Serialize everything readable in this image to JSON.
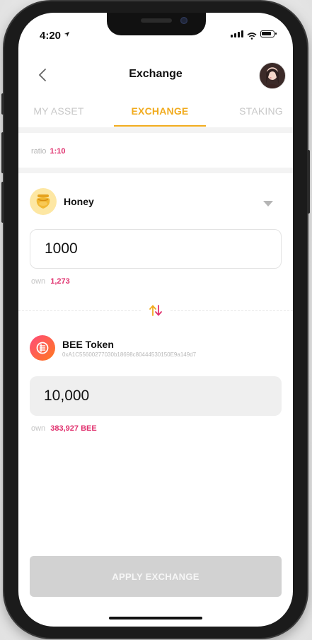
{
  "status_bar": {
    "time": "4:20"
  },
  "header": {
    "title": "Exchange"
  },
  "tabs": [
    {
      "label": "MY ASSET",
      "active": false
    },
    {
      "label": "EXCHANGE",
      "active": true
    },
    {
      "label": "STAKING",
      "active": false
    }
  ],
  "ratio": {
    "label": "ratio",
    "value": "1:10"
  },
  "from_token": {
    "name": "Honey",
    "amount": "1000",
    "own_label": "own",
    "own_value": "1,273"
  },
  "to_token": {
    "name": "BEE Token",
    "address": "0xA1C55600277030b18698c80444530150E9a149d7",
    "amount": "10,000",
    "own_label": "own",
    "own_value": "383,927 BEE"
  },
  "apply_button": {
    "label": "APPLY EXCHANGE"
  },
  "colors": {
    "accent": "#f1ab1e",
    "highlight": "#e0316e",
    "disabled": "#d2d2d2"
  },
  "icons": [
    "back-chevron-icon",
    "location-arrow-icon",
    "signal-icon",
    "wifi-icon",
    "battery-icon",
    "honey-pot-icon",
    "bee-token-icon",
    "dropdown-caret-icon",
    "swap-arrows-icon"
  ]
}
